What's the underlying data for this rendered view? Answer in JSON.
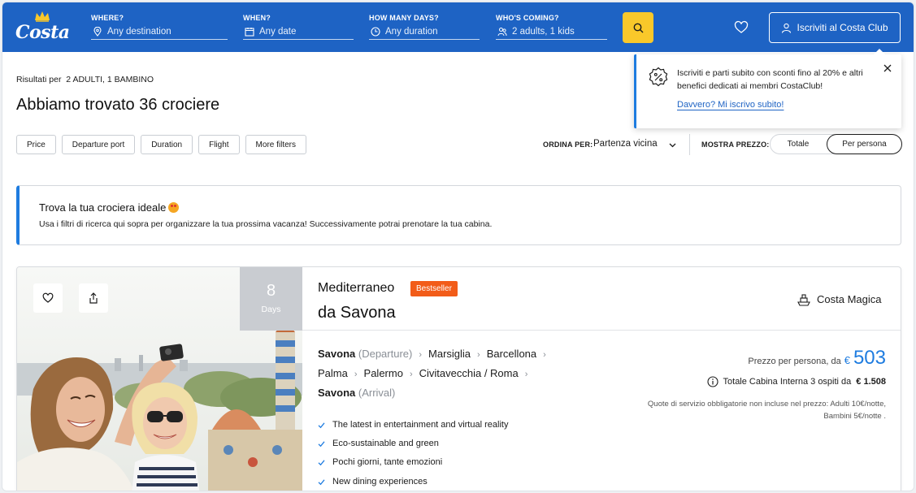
{
  "header": {
    "logo_text": "Costa",
    "fields": [
      {
        "label": "WHERE?",
        "value": "Any destination",
        "icon": "pin-icon"
      },
      {
        "label": "WHEN?",
        "value": "Any date",
        "icon": "calendar-icon"
      },
      {
        "label": "HOW MANY DAYS?",
        "value": "Any duration",
        "icon": "clock-icon"
      },
      {
        "label": "WHO'S COMING?",
        "value": "2 adults, 1 kids",
        "icon": "people-icon"
      }
    ],
    "search_icon": "search-icon",
    "favorites_icon": "heart-icon",
    "club_button": "Iscriviti al Costa Club",
    "colors": {
      "bar": "#1e63c4",
      "search": "#f9c82a"
    }
  },
  "results": {
    "label": "Risultati per",
    "party": "2 ADULTI, 1 BAMBINO",
    "title": "Abbiamo trovato 36 crociere"
  },
  "filters": [
    "Price",
    "Departure port",
    "Duration",
    "Flight",
    "More filters"
  ],
  "sort": {
    "label": "ORDINA PER:",
    "value": "Partenza vicina"
  },
  "price_display": {
    "label": "MOSTRA PREZZO:",
    "options": [
      "Totale",
      "Per persona"
    ],
    "selected": "Per persona"
  },
  "popup": {
    "message": "Iscriviti e parti subito con sconti fino al 20% e altri benefici dedicati ai membri CostaClub!",
    "link": "Davvero? Mi iscrivo subito!"
  },
  "banner": {
    "title": "Trova la tua crociera ideale",
    "text": "Usa i filtri di ricerca qui sopra per organizzare la tua prossima vacanza! Successivamente potrai prenotare la tua cabina."
  },
  "card": {
    "days_number": "8",
    "days_label": "Days",
    "destination": "Mediterraneo",
    "badge": "Bestseller",
    "from": "da Savona",
    "ship": "Costa Magica",
    "route": {
      "departure_port": "Savona",
      "departure_tag": "(Departure)",
      "stops_line1": [
        "Marsiglia",
        "Barcellona"
      ],
      "stops_line2": [
        "Palma",
        "Palermo",
        "Civitavecchia / Roma"
      ],
      "arrival_port": "Savona",
      "arrival_tag": "(Arrival)"
    },
    "features": [
      "The latest in entertainment and virtual reality",
      "Eco-sustainable and green",
      "Pochi giorni, tante emozioni",
      "New dining experiences"
    ],
    "price_label": "Prezzo per persona, da",
    "currency": "€",
    "price": "503",
    "total_label": "Totale Cabina Interna 3 ospiti da",
    "total_value": "€ 1.508",
    "fine_print": "Quote di servizio obbligatorie non incluse nel prezzo: Adulti 10€/notte, Bambini 5€/notte ."
  }
}
